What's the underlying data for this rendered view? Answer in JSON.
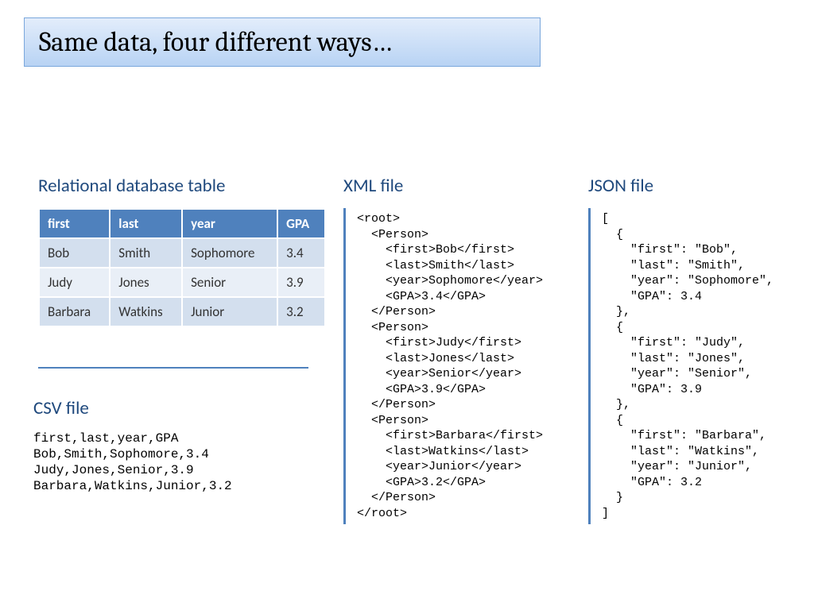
{
  "title": "Same data, four different ways…",
  "db": {
    "heading": "Relational database table",
    "cols": [
      "first",
      "last",
      "year",
      "GPA"
    ],
    "rows": [
      [
        "Bob",
        "Smith",
        "Sophomore",
        "3.4"
      ],
      [
        "Judy",
        "Jones",
        "Senior",
        "3.9"
      ],
      [
        "Barbara",
        "Watkins",
        "Junior",
        "3.2"
      ]
    ]
  },
  "csv": {
    "heading": "CSV file",
    "body": "first,last,year,GPA\nBob,Smith,Sophomore,3.4\nJudy,Jones,Senior,3.9\nBarbara,Watkins,Junior,3.2"
  },
  "xml": {
    "heading": "XML file",
    "body": "<root>\n  <Person>\n    <first>Bob</first>\n    <last>Smith</last>\n    <year>Sophomore</year>\n    <GPA>3.4</GPA>\n  </Person>\n  <Person>\n    <first>Judy</first>\n    <last>Jones</last>\n    <year>Senior</year>\n    <GPA>3.9</GPA>\n  </Person>\n  <Person>\n    <first>Barbara</first>\n    <last>Watkins</last>\n    <year>Junior</year>\n    <GPA>3.2</GPA>\n  </Person>\n</root>"
  },
  "json": {
    "heading": "JSON file",
    "body": "[\n  {\n    \"first\": \"Bob\",\n    \"last\": \"Smith\",\n    \"year\": \"Sophomore\",\n    \"GPA\": 3.4\n  },\n  {\n    \"first\": \"Judy\",\n    \"last\": \"Jones\",\n    \"year\": \"Senior\",\n    \"GPA\": 3.9\n  },\n  {\n    \"first\": \"Barbara\",\n    \"last\": \"Watkins\",\n    \"year\": \"Junior\",\n    \"GPA\": 3.2\n  }\n]"
  }
}
